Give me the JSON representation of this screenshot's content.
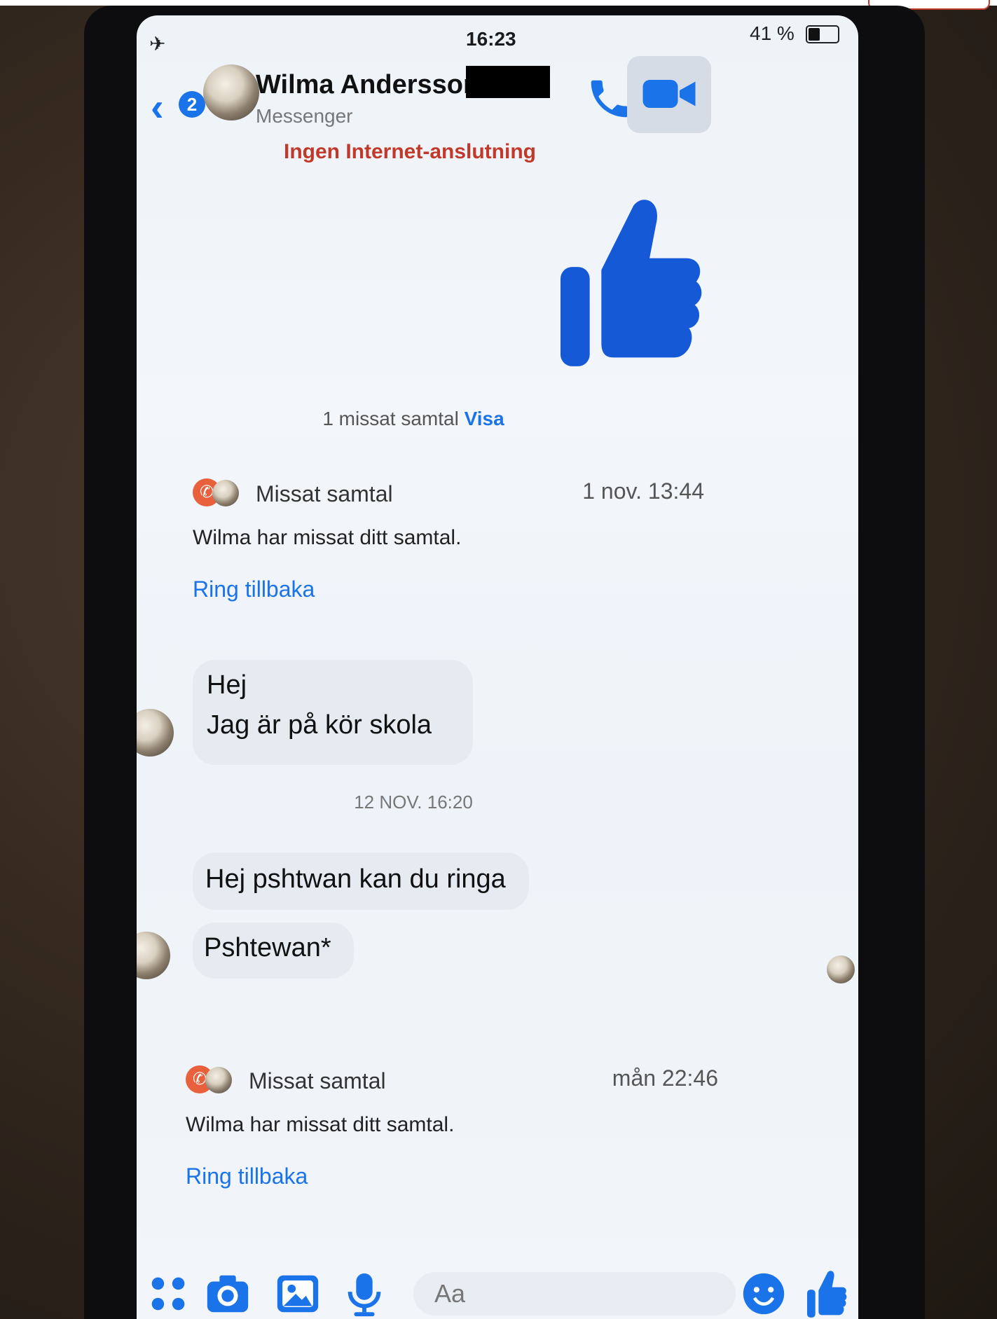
{
  "status_bar": {
    "time": "16:23",
    "battery_label": "41 %",
    "battery_level": 0.41
  },
  "header": {
    "back_count": "2",
    "contact_name": "Wilma Andersson",
    "subtitle": "Messenger",
    "connection_warning": "Ingen Internet-anslutning"
  },
  "conversation": {
    "missed_summary_text": "1 missat samtal",
    "missed_summary_link": "Visa",
    "call_cards": [
      {
        "title": "Missat samtal",
        "time": "1 nov. 13:44",
        "text": "Wilma har missat ditt samtal.",
        "action": "Ring tillbaka"
      },
      {
        "title": "Missat samtal",
        "time": "mån 22:46",
        "text": "Wilma har missat ditt samtal.",
        "action": "Ring tillbaka"
      }
    ],
    "messages_group1": [
      "Hej",
      "Jag är på kör skola"
    ],
    "date_separator": "12 NOV. 16:20",
    "messages_group2": [
      "Hej pshtwan kan du ringa",
      "Pshtewan*"
    ]
  },
  "composer": {
    "placeholder": "Aa"
  },
  "icons": {
    "back": "back-chevron-icon",
    "call": "phone-icon",
    "video": "video-camera-icon",
    "like": "thumbs-up-icon",
    "menu": "four-dots-icon",
    "camera": "camera-icon",
    "gallery": "image-icon",
    "mic": "microphone-icon",
    "emoji": "smiley-icon",
    "airplane": "airplane-mode-icon"
  },
  "colors": {
    "accent": "#1a73e8",
    "warning": "#c0392b",
    "missed_call_red": "#e8613c"
  }
}
